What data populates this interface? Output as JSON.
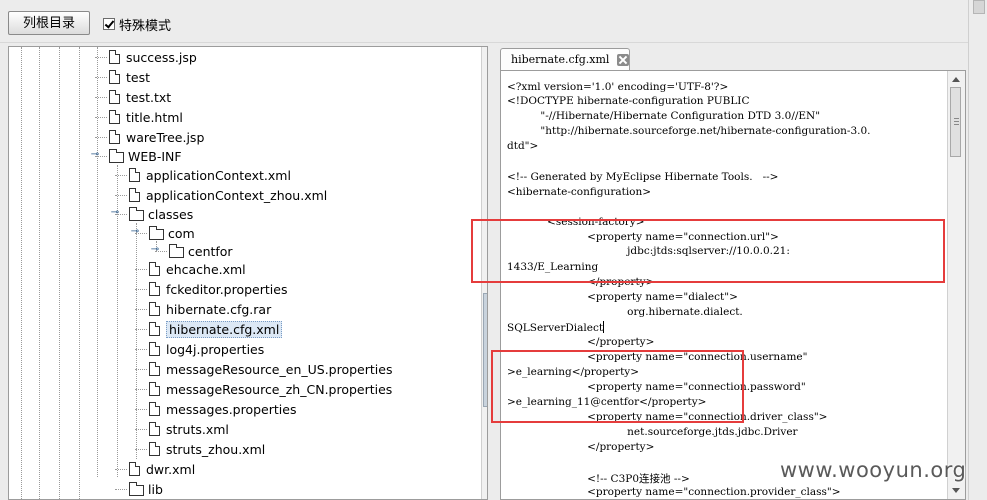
{
  "toolbar": {
    "list_button_label": "列根目录",
    "special_mode_label": "特殊模式",
    "special_mode_checked": true
  },
  "tree": {
    "items": [
      {
        "label": "success.jsp",
        "type": "file"
      },
      {
        "label": "test",
        "type": "file"
      },
      {
        "label": "test.txt",
        "type": "file"
      },
      {
        "label": "title.html",
        "type": "file"
      },
      {
        "label": "wareTree.jsp",
        "type": "file"
      },
      {
        "label": "WEB-INF",
        "type": "folder"
      },
      {
        "label": "applicationContext.xml",
        "type": "file"
      },
      {
        "label": "applicationContext_zhou.xml",
        "type": "file"
      },
      {
        "label": "classes",
        "type": "folder"
      },
      {
        "label": "com",
        "type": "folder"
      },
      {
        "label": "centfor",
        "type": "folder"
      },
      {
        "label": "ehcache.xml",
        "type": "file"
      },
      {
        "label": "fckeditor.properties",
        "type": "file"
      },
      {
        "label": "hibernate.cfg.rar",
        "type": "file"
      },
      {
        "label": "hibernate.cfg.xml",
        "type": "file",
        "selected": true
      },
      {
        "label": "log4j.properties",
        "type": "file"
      },
      {
        "label": "messageResource_en_US.properties",
        "type": "file"
      },
      {
        "label": "messageResource_zh_CN.properties",
        "type": "file"
      },
      {
        "label": "messages.properties",
        "type": "file"
      },
      {
        "label": "struts.xml",
        "type": "file"
      },
      {
        "label": "struts_zhou.xml",
        "type": "file"
      },
      {
        "label": "dwr.xml",
        "type": "file"
      },
      {
        "label": "lib",
        "type": "folder"
      }
    ]
  },
  "editor": {
    "tab_label": "hibernate.cfg.xml",
    "lines": [
      "<?xml version='1.0' encoding='UTF-8'?>",
      "<!DOCTYPE hibernate-configuration PUBLIC",
      "          \"-//Hibernate/Hibernate Configuration DTD 3.0//EN\"",
      "          \"http://hibernate.sourceforge.net/hibernate-configuration-3.0.",
      "dtd\">",
      "",
      "<!-- Generated by MyEclipse Hibernate Tools.   -->",
      "<hibernate-configuration>",
      "",
      "            <session-factory>",
      "                        <property name=\"connection.url\">",
      "                                    jdbc:jtds:sqlserver://10.0.0.21:",
      "1433/E_Learning",
      "                        </property>",
      "                        <property name=\"dialect\">",
      "                                    org.hibernate.dialect.",
      "SQLServerDialect",
      "                        </property>",
      "                        <property name=\"connection.username\"",
      ">e_learning</property>",
      "                        <property name=\"connection.password\"",
      ">e_learning_11@centfor</property>",
      "                        <property name=\"connection.driver_class\">",
      "                                    net.sourceforge.jtds.jdbc.Driver",
      "                        </property>",
      "",
      "                        <!-- C3P0连接池 -->",
      "                        <property name=\"connection.provider_class\">"
    ]
  },
  "watermark": "www.wooyun.org",
  "colors": {
    "annotation_red": "#e53c3c",
    "selection_bg": "#dce8f5"
  }
}
